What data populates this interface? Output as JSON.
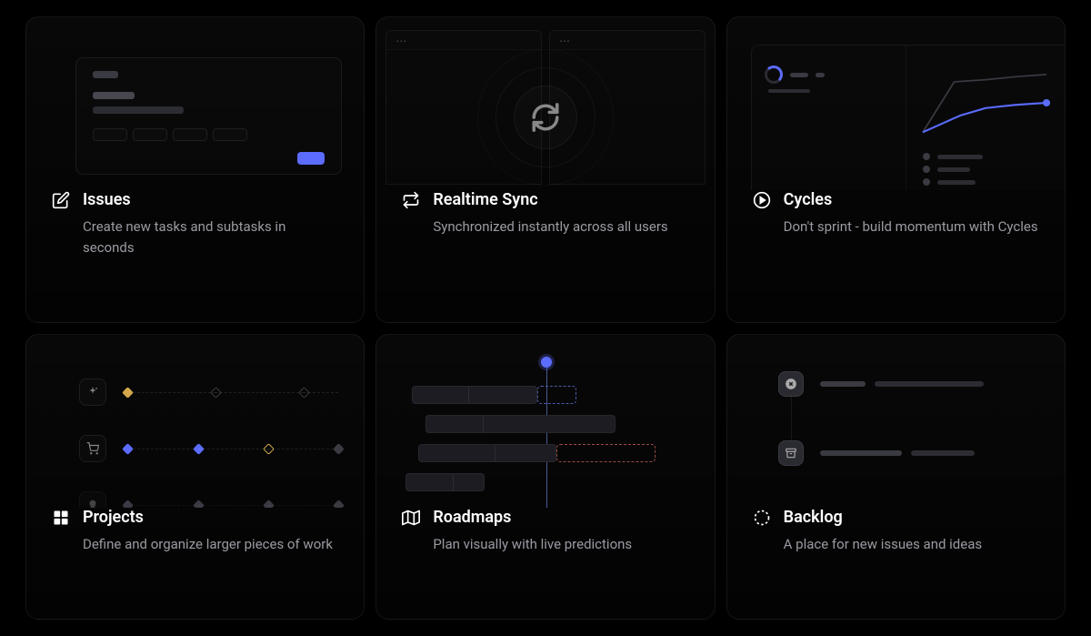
{
  "colors": {
    "accent": "#5b6cff",
    "amber": "#d4a94c"
  },
  "cards": [
    {
      "icon": "edit",
      "title": "Issues",
      "desc": "Create new tasks and subtasks in seconds"
    },
    {
      "icon": "sync",
      "title": "Realtime Sync",
      "desc": "Synchronized instantly across all users"
    },
    {
      "icon": "play",
      "title": "Cycles",
      "desc": "Don't sprint - build momentum with Cycles"
    },
    {
      "icon": "grid",
      "title": "Projects",
      "desc": "Define and organize larger pieces of work"
    },
    {
      "icon": "map",
      "title": "Roadmaps",
      "desc": "Plan visually with live predictions"
    },
    {
      "icon": "dashed-circle",
      "title": "Backlog",
      "desc": "A place for new issues and ideas"
    }
  ]
}
